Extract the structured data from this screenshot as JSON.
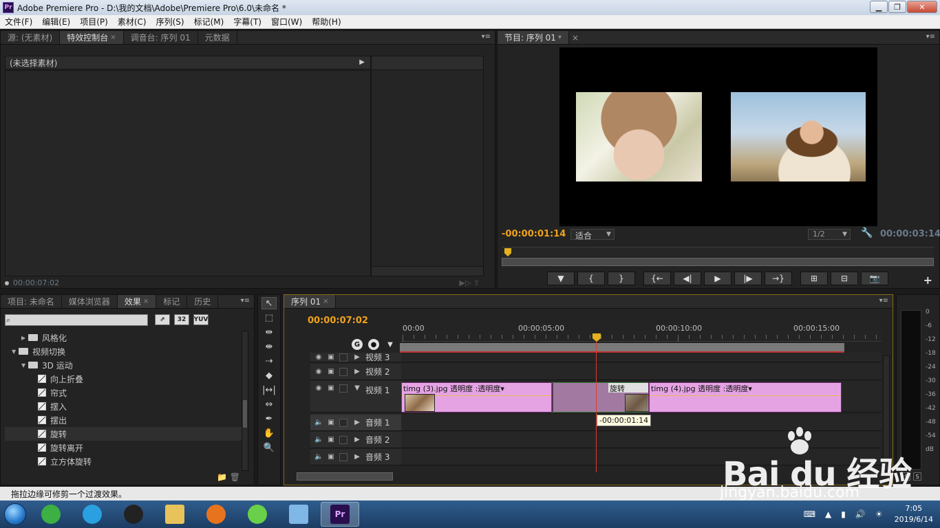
{
  "window": {
    "title": "Adobe Premiere Pro - D:\\我的文档\\Adobe\\Premiere Pro\\6.0\\未命名 *",
    "app_icon": "Pr"
  },
  "menu": [
    "文件(F)",
    "编辑(E)",
    "项目(P)",
    "素材(C)",
    "序列(S)",
    "标记(M)",
    "字幕(T)",
    "窗口(W)",
    "帮助(H)"
  ],
  "source_panel": {
    "tabs": [
      "源: (无素材)",
      "特效控制台",
      "调音台: 序列 01",
      "元数据"
    ],
    "header": "(未选择素材)",
    "timecode": "00:00:07:02"
  },
  "program_panel": {
    "tab": "节目: 序列 01",
    "timecode_left": "-00:00:01:14",
    "fit": "适合",
    "resolution": "1/2",
    "timecode_right": "00:00:03:14",
    "controls": [
      "marker-button",
      "mark-in-button",
      "mark-out-button",
      "go-to-in-button",
      "step-back-button",
      "play-button",
      "step-forward-button",
      "go-to-out-button",
      "lift-button",
      "extract-button",
      "export-frame-button"
    ],
    "control_glyphs": [
      "▼",
      "{",
      "}",
      "{←",
      "◀|",
      "▶",
      "|▶",
      "→}",
      "⊞",
      "⊟",
      "📷"
    ]
  },
  "effects_panel": {
    "tabs": [
      "项目: 未命名",
      "媒体浏览器",
      "效果",
      "标记",
      "历史"
    ],
    "search_placeholder": "",
    "buttons": [
      "⇗",
      "32",
      "YUV"
    ],
    "tree": [
      {
        "label": "风格化",
        "level": 1,
        "type": "folder",
        "expanded": false
      },
      {
        "label": "视频切换",
        "level": 0,
        "type": "folder",
        "expanded": true
      },
      {
        "label": "3D 运动",
        "level": 1,
        "type": "folder",
        "expanded": true
      },
      {
        "label": "向上折叠",
        "level": 2,
        "type": "effect"
      },
      {
        "label": "帘式",
        "level": 2,
        "type": "effect"
      },
      {
        "label": "摆入",
        "level": 2,
        "type": "effect"
      },
      {
        "label": "摆出",
        "level": 2,
        "type": "effect"
      },
      {
        "label": "旋转",
        "level": 2,
        "type": "effect",
        "selected": true
      },
      {
        "label": "旋转离开",
        "level": 2,
        "type": "effect"
      },
      {
        "label": "立方体旋转",
        "level": 2,
        "type": "effect"
      }
    ]
  },
  "timeline": {
    "tab": "序列 01",
    "timecode": "00:00:07:02",
    "ruler": [
      "00:00",
      "00:00:05:00",
      "00:00:10:00",
      "00:00:15:00"
    ],
    "tracks": [
      {
        "name": "视频 3",
        "kind": "video"
      },
      {
        "name": "视频 2",
        "kind": "video"
      },
      {
        "name": "视频 1",
        "kind": "video"
      },
      {
        "name": "音频 1",
        "kind": "audio"
      },
      {
        "name": "音频 2",
        "kind": "audio"
      },
      {
        "name": "音频 3",
        "kind": "audio"
      }
    ],
    "clips": [
      {
        "name": "timg (3).jpg",
        "effect": "透明度 :透明度▾"
      },
      {
        "name": "timg (4).jpg",
        "effect": "透明度 :透明度▾"
      }
    ],
    "transition": "旋转",
    "tooltip": "-00:00:01:14"
  },
  "meters": {
    "db_labels": [
      "0",
      "-6",
      "-12",
      "-18",
      "-24",
      "-30",
      "-36",
      "-42",
      "-48",
      "-54",
      "dB"
    ],
    "solo": [
      "S",
      "S"
    ]
  },
  "status": "拖拉边缘可修剪一个过渡效果。",
  "taskbar": {
    "apps": [
      {
        "name": "start-icon"
      },
      {
        "name": "refresh-app-icon",
        "color": "#3cb043"
      },
      {
        "name": "media-player-icon",
        "color": "#2aa0e0"
      },
      {
        "name": "qq-icon",
        "color": "#222222"
      },
      {
        "name": "file-explorer-icon",
        "color": "#e8c25a"
      },
      {
        "name": "firefox-icon",
        "color": "#e8731e"
      },
      {
        "name": "video-app-icon",
        "color": "#6ad04a"
      },
      {
        "name": "blank-window-icon",
        "color": "#7fb7e6"
      },
      {
        "name": "premiere-icon",
        "color": "#2a0f4f",
        "label": "Pr",
        "active": true
      }
    ],
    "time": "7:05",
    "date": "2019/6/14"
  },
  "watermark": {
    "brand": "Bai du 经验",
    "url": "jingyan.baidu.com"
  }
}
